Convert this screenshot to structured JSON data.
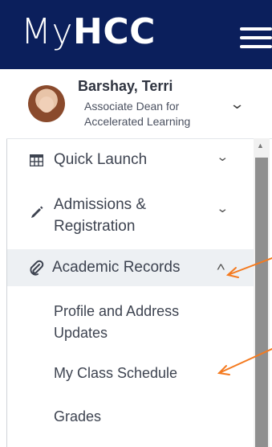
{
  "header": {
    "logo_prefix": "My",
    "logo_bold": "HCC"
  },
  "profile": {
    "name": "Barshay, Terri",
    "title": "Associate Dean for Accelerated Learning"
  },
  "nav": {
    "quick_launch": "Quick Launch",
    "admissions": "Admissions & Registration",
    "academic_records": "Academic Records",
    "sub_items": [
      "Profile and Address Updates",
      "My Class Schedule",
      "Grades"
    ]
  },
  "colors": {
    "header_bg": "#0b1f5c",
    "annotation_arrow": "#f47a1f",
    "active_row_bg": "#edf0f3"
  },
  "icons": [
    "table-grid-icon",
    "pencil-icon",
    "paperclip-icon",
    "chevron-down-icon",
    "chevron-up-icon",
    "hamburger-menu-icon"
  ]
}
